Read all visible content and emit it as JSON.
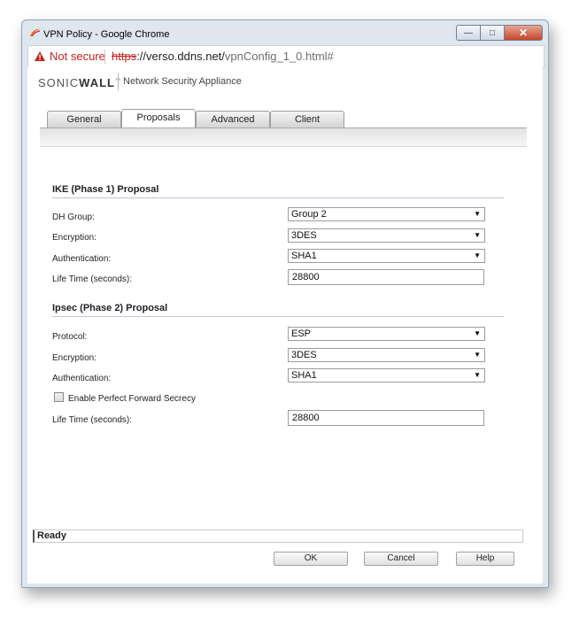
{
  "window": {
    "title": "VPN Policy - Google Chrome",
    "controls": {
      "minimize": "—",
      "maximize": "□",
      "close": "✕"
    }
  },
  "urlbar": {
    "security_label": "Not secure",
    "scheme": "https",
    "host": "://verso.ddns.net/",
    "path": "vpnConfig_1_0.html#",
    "warning_color": "#c5221f"
  },
  "header": {
    "brand_prefix": "SONIC",
    "brand_suffix": "WALL",
    "trademark": "™",
    "product": "Network Security Appliance"
  },
  "tabs": [
    {
      "label": "General",
      "active": false
    },
    {
      "label": "Proposals",
      "active": true
    },
    {
      "label": "Advanced",
      "active": false
    },
    {
      "label": "Client",
      "active": false
    }
  ],
  "ike": {
    "heading": "IKE (Phase 1) Proposal",
    "dh_group_label": "DH Group:",
    "dh_group_value": "Group 2",
    "encryption_label": "Encryption:",
    "encryption_value": "3DES",
    "authentication_label": "Authentication:",
    "authentication_value": "SHA1",
    "lifetime_label": "Life Time (seconds):",
    "lifetime_value": "28800"
  },
  "ipsec": {
    "heading": "Ipsec (Phase 2) Proposal",
    "protocol_label": "Protocol:",
    "protocol_value": "ESP",
    "encryption_label": "Encryption:",
    "encryption_value": "3DES",
    "authentication_label": "Authentication:",
    "authentication_value": "SHA1",
    "pfs_label": "Enable Perfect Forward Secrecy",
    "pfs_checked": false,
    "lifetime_label": "Life Time (seconds):",
    "lifetime_value": "28800"
  },
  "status_text": "Ready",
  "buttons": {
    "ok": "OK",
    "cancel": "Cancel",
    "help": "Help"
  },
  "dropdown_arrow": "▼"
}
